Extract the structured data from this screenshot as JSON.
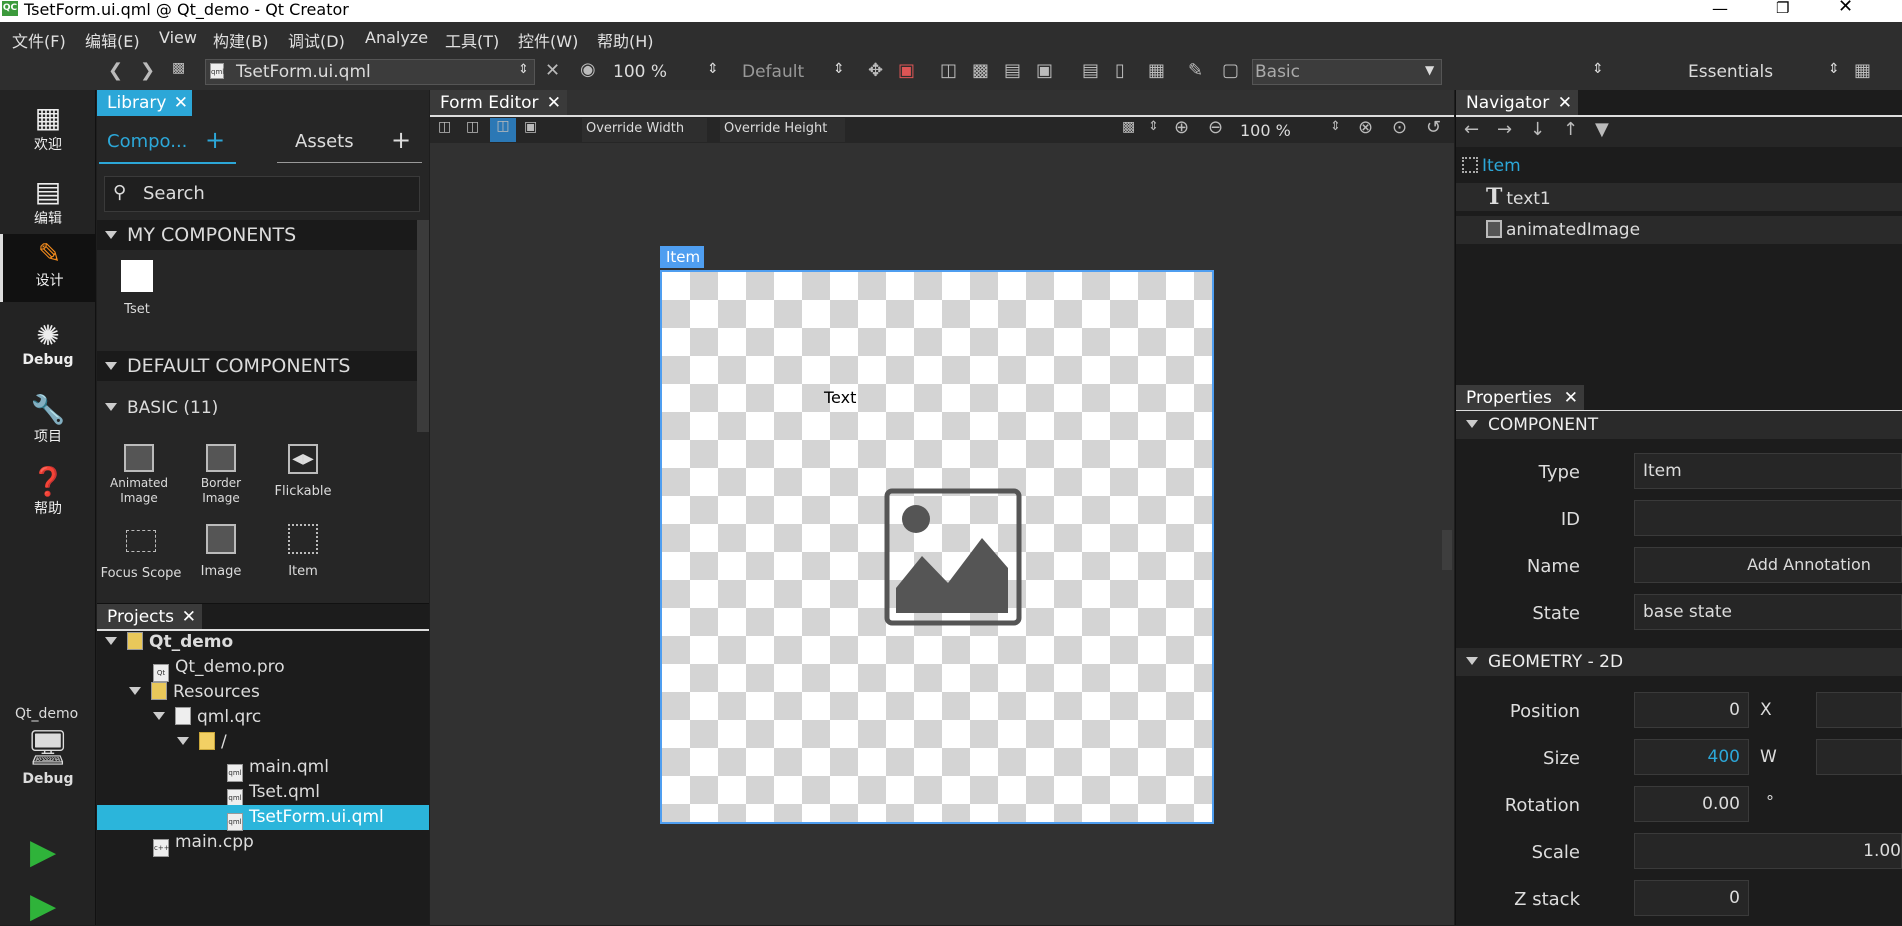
{
  "window": {
    "title": "TsetForm.ui.qml @ Qt_demo - Qt Creator",
    "app_icon": "QC"
  },
  "menu": [
    "文件(F)",
    "编辑(E)",
    "View",
    "构建(B)",
    "调试(D)",
    "Analyze",
    "工具(T)",
    "控件(W)",
    "帮助(H)"
  ],
  "toolbar": {
    "file": "TsetForm.ui.qml",
    "zoom": "100 %",
    "style": "Default",
    "preset": "Basic",
    "workspace": "Essentials"
  },
  "modes": [
    {
      "label": "欢迎",
      "icon": "grid-icon"
    },
    {
      "label": "编辑",
      "icon": "document-icon"
    },
    {
      "label": "设计",
      "icon": "pen-icon"
    },
    {
      "label": "Debug",
      "icon": "bug-icon"
    },
    {
      "label": "项目",
      "icon": "wrench-icon"
    },
    {
      "label": "帮助",
      "icon": "help-icon"
    }
  ],
  "kit": {
    "project": "Qt_demo",
    "label": "Debug"
  },
  "library": {
    "tab": "Library",
    "components_tab": "Compo...",
    "assets_tab": "Assets",
    "search_placeholder": "Search",
    "my_components": "MY COMPONENTS",
    "my_items": [
      "Tset"
    ],
    "default_components": "DEFAULT COMPONENTS",
    "basic": "BASIC (11)",
    "basic_items": [
      [
        "Animated",
        "Image"
      ],
      [
        "Border",
        "Image"
      ],
      [
        "Flickable",
        ""
      ],
      [
        "Focus Scope",
        ""
      ],
      [
        "Image",
        ""
      ],
      [
        "Item",
        ""
      ]
    ]
  },
  "projects": {
    "tab": "Projects",
    "tree": [
      "Qt_demo",
      "Qt_demo.pro",
      "Resources",
      "qml.qrc",
      "/",
      "main.qml",
      "Tset.qml",
      "TsetForm.ui.qml",
      "main.cpp"
    ],
    "selected": "TsetForm.ui.qml"
  },
  "form_editor": {
    "tab": "Form Editor",
    "override_width": "Override Width",
    "override_height": "Override Height",
    "zoom": "100 %",
    "item_label": "Item",
    "text_item": "Text"
  },
  "navigator": {
    "tab": "Navigator",
    "items": [
      "Item",
      "text1",
      "animatedImage"
    ]
  },
  "properties": {
    "tab": "Properties",
    "component": "COMPONENT",
    "type_label": "Type",
    "type": "Item",
    "id_label": "ID",
    "id": "",
    "name_label": "Name",
    "add_annotation": "Add Annotation",
    "state_label": "State",
    "state": "base state",
    "geometry": "GEOMETRY - 2D",
    "position_label": "Position",
    "position_x": "0",
    "x_axis": "X",
    "size_label": "Size",
    "size_w": "400",
    "w_axis": "W",
    "rotation_label": "Rotation",
    "rotation": "0.00",
    "deg": "°",
    "scale_label": "Scale",
    "scale": "1.00",
    "z_label": "Z stack",
    "z": "0"
  },
  "colors": {
    "accent": "#2ca7d8",
    "selection": "#2bb5db",
    "canvas_border": "#4f9ef0"
  }
}
